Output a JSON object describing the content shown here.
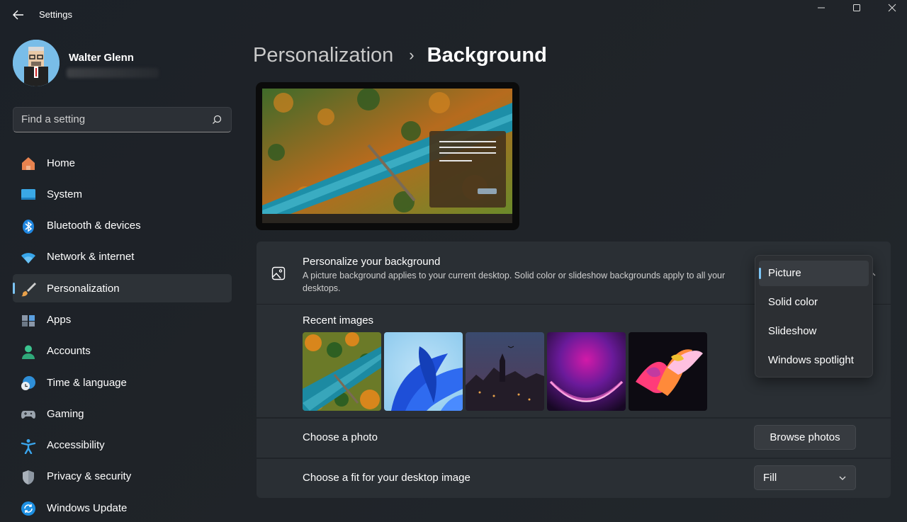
{
  "window": {
    "title": "Settings",
    "controls": [
      "minimize",
      "maximize",
      "close"
    ]
  },
  "profile": {
    "name": "Walter Glenn"
  },
  "search": {
    "placeholder": "Find a setting"
  },
  "sidebar": {
    "items": [
      {
        "label": "Home",
        "icon": "home-icon"
      },
      {
        "label": "System",
        "icon": "system-icon"
      },
      {
        "label": "Bluetooth & devices",
        "icon": "bluetooth-icon"
      },
      {
        "label": "Network & internet",
        "icon": "wifi-icon"
      },
      {
        "label": "Personalization",
        "icon": "brush-icon",
        "active": true
      },
      {
        "label": "Apps",
        "icon": "apps-icon"
      },
      {
        "label": "Accounts",
        "icon": "accounts-icon"
      },
      {
        "label": "Time & language",
        "icon": "globe-clock-icon"
      },
      {
        "label": "Gaming",
        "icon": "gamepad-icon"
      },
      {
        "label": "Accessibility",
        "icon": "accessibility-icon"
      },
      {
        "label": "Privacy & security",
        "icon": "shield-icon"
      },
      {
        "label": "Windows Update",
        "icon": "update-icon"
      }
    ]
  },
  "breadcrumb": {
    "parent": "Personalization",
    "separator": "›",
    "current": "Background"
  },
  "background_card": {
    "title": "Personalize your background",
    "description": "A picture background applies to your current desktop. Solid color or slideshow backgrounds apply to all your desktops.",
    "recent_label": "Recent images",
    "recent_images": [
      "forest-river-bridge",
      "blue-bloom",
      "dark-fantasy-town",
      "purple-glow",
      "abstract-ribbons"
    ]
  },
  "choose_photo": {
    "label": "Choose a photo",
    "button": "Browse photos"
  },
  "choose_fit": {
    "label": "Choose a fit for your desktop image",
    "value": "Fill"
  },
  "background_type_dropdown": {
    "selected": "Picture",
    "options": [
      "Picture",
      "Solid color",
      "Slideshow",
      "Windows spotlight"
    ]
  },
  "colors": {
    "accent": "#7cc4f4",
    "card": "#2a2f34",
    "window_bg": "#1f2328"
  }
}
